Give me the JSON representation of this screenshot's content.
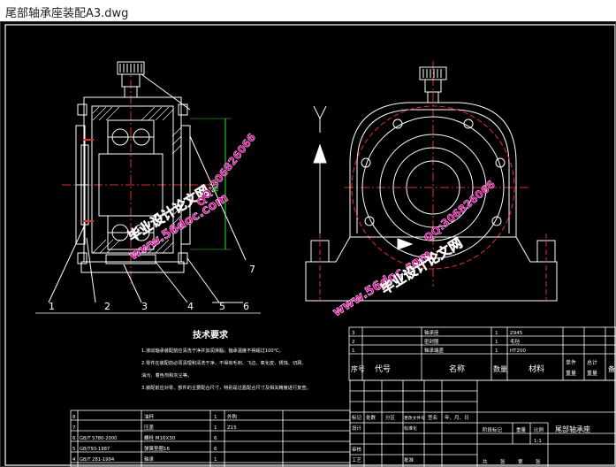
{
  "window": {
    "title": "尾部轴承座装配A3.dwg"
  },
  "colors": {
    "background": "#000000",
    "line": "#ffffff",
    "center": "#e03030",
    "dim": "#30e030",
    "watermark": "#e0009a"
  },
  "balloons": [
    "1",
    "2",
    "3",
    "4",
    "5",
    "6",
    "7"
  ],
  "dimension_label": "轴承",
  "watermarks": {
    "site": "www.56doc.com",
    "brand": "毕业设计论文网",
    "qq": "QQ:306826066"
  },
  "technical": {
    "heading": "技术要求",
    "lines": [
      "1.滚动轴承装配前应清洗干净并加润滑脂，轴承温度不得超过100℃。",
      "2.零件在装配前必须清理和清洗干净，不得有毛刺、飞边、氧化皮、锈蚀、切屑、",
      "油污、着色剂和灰尘等。",
      "3.装配前应对零、部件的主要配合尺寸，特别是过盈配合尺寸及相关精度进行复查。"
    ]
  },
  "bom_upper": {
    "rows": [
      {
        "no": "3",
        "name": "轴承座",
        "qty": "1",
        "material": "Z945"
      },
      {
        "no": "2",
        "name": "密封圈",
        "qty": "1",
        "material": "毛毡"
      },
      {
        "no": "1",
        "name": "轴承端盖",
        "qty": "1",
        "material": "HT200"
      }
    ],
    "header": {
      "no": "序号",
      "code": "代号",
      "name": "名称",
      "qty": "数量",
      "material": "材料",
      "unit_w1": "单件",
      "unit_w2": "重量",
      "total_w1": "总计",
      "total_w2": "重量",
      "note": "备"
    }
  },
  "bom_lower": {
    "rows": [
      {
        "no": "8",
        "code": "",
        "name": "油杯",
        "qty": "1",
        "mat": "外购"
      },
      {
        "no": "7",
        "code": "",
        "name": "压盖",
        "qty": "1",
        "mat": "Z15"
      },
      {
        "no": "6",
        "code": "GB/T 5780-2000",
        "name": "螺栓 M16X30",
        "qty": "6",
        "mat": ""
      },
      {
        "no": "5",
        "code": "GB/T93-1987",
        "name": "弹簧垫圈16",
        "qty": "6",
        "mat": ""
      },
      {
        "no": "4",
        "code": "GB/T 281-1994",
        "name": "轴承",
        "qty": "1",
        "mat": ""
      }
    ]
  },
  "title_block": {
    "row1": [
      "标记",
      "处数",
      "分区",
      "更改文件号",
      "签名",
      "年、月、日"
    ],
    "design": "设计",
    "standard": "标准化",
    "stage": "阶段标记",
    "weight": "重量",
    "scale": "比例",
    "scale_value": "1:1",
    "review": "审核",
    "process": "工艺",
    "approve": "批准",
    "total": "共",
    "sheet": "张",
    "page": "第",
    "drawing_name": "尾部轴承座"
  }
}
